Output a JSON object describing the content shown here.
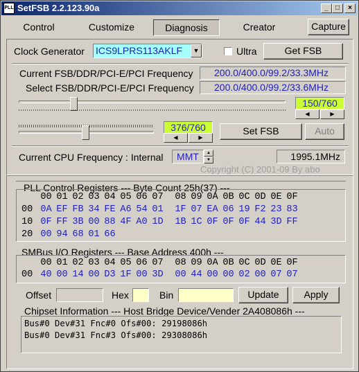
{
  "window": {
    "title": "SetFSB 2.2.123.90a",
    "icon_label": "PLL"
  },
  "titlebar_buttons": {
    "minimize": "_",
    "maximize": "□",
    "close": "×"
  },
  "tabs": {
    "control": "Control",
    "customize": "Customize",
    "diagnosis": "Diagnosis",
    "creator": "Creator",
    "capture": "Capture"
  },
  "clock": {
    "label": "Clock Generator",
    "value": "ICS9LPRS113AKLF",
    "ultra_label": "Ultra",
    "get_fsb": "Get FSB"
  },
  "freq": {
    "current_label": "Current FSB/DDR/PCI-E/PCI Frequency",
    "current_value": "200.0/400.0/99.2/33.3MHz",
    "select_label": "Select FSB/DDR/PCI-E/PCI Frequency",
    "select_value": "200.0/400.0/99.2/33.6MHz",
    "slider1_value": "150/760",
    "slider1_level": 0.197,
    "slider2_value": "376/760",
    "slider2_level": 0.495,
    "set_fsb": "Set FSB",
    "auto": "Auto"
  },
  "cpu": {
    "label": "Current CPU Frequency : Internal",
    "mode": "MMT",
    "value": "1995.1MHz"
  },
  "copyright": "Copyright (C) 2001-09 By abo",
  "pll": {
    "header": "PLL Control Registers  --- Byte Count 25h(37) ---",
    "cols": [
      "00",
      "01",
      "02",
      "03",
      "04",
      "05",
      "06",
      "07",
      "08",
      "09",
      "0A",
      "0B",
      "0C",
      "0D",
      "0E",
      "0F"
    ],
    "rows": [
      {
        "label": "00",
        "cells": [
          "0A",
          "EF",
          "FB",
          "34",
          "FE",
          "A6",
          "54",
          "01",
          "1F",
          "07",
          "EA",
          "06",
          "19",
          "F2",
          "23",
          "83"
        ]
      },
      {
        "label": "10",
        "cells": [
          "0F",
          "FF",
          "3B",
          "00",
          "88",
          "4F",
          "A0",
          "1D",
          "1B",
          "1C",
          "0F",
          "0F",
          "0F",
          "44",
          "3D",
          "FF"
        ]
      },
      {
        "label": "20",
        "cells": [
          "00",
          "94",
          "68",
          "01",
          "66",
          "",
          "",
          "",
          "",
          "",
          "",
          "",
          "",
          "",
          "",
          ""
        ]
      }
    ]
  },
  "smbus": {
    "header": "SMBus I/O Registers  --- Base Address 400h ---",
    "cols": [
      "00",
      "01",
      "02",
      "03",
      "04",
      "05",
      "06",
      "07",
      "08",
      "09",
      "0A",
      "0B",
      "0C",
      "0D",
      "0E",
      "0F"
    ],
    "rows": [
      {
        "label": "00",
        "cells": [
          "40",
          "00",
          "14",
          "00",
          "D3",
          "1F",
          "00",
          "3D",
          "00",
          "44",
          "00",
          "00",
          "02",
          "00",
          "07",
          "07"
        ]
      }
    ]
  },
  "io": {
    "offset_label": "Offset",
    "hex_label": "Hex",
    "bin_label": "Bin",
    "update": "Update",
    "apply": "Apply"
  },
  "chipset": {
    "header": "Chipset Information  --- Host Bridge Device/Vender 2A408086h ---",
    "lines": [
      "Bus#0 Dev#31 Fnc#0 Ofs#00: 29198086h",
      "Bus#0 Dev#31 Fnc#3 Ofs#00: 29308086h"
    ]
  }
}
